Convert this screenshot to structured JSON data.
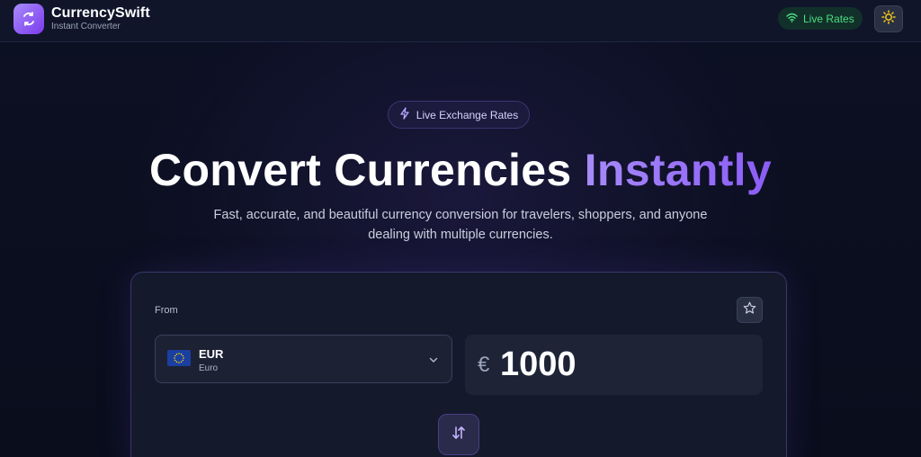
{
  "header": {
    "brand_name": "CurrencySwift",
    "brand_subtitle": "Instant Converter",
    "live_rates_label": "Live Rates",
    "theme_icon": "sun-icon",
    "logo_icon": "currency-exchange-icon"
  },
  "hero": {
    "badge_label": "Live Exchange Rates",
    "badge_icon": "lightning-icon",
    "headline_main": "Convert Currencies ",
    "headline_accent": "Instantly",
    "subtitle": "Fast, accurate, and beautiful currency conversion for travelers, shoppers, and anyone dealing with multiple currencies."
  },
  "converter": {
    "from_label": "From",
    "from_currency": {
      "code": "EUR",
      "name": "Euro",
      "flag_icon": "eu-flag-icon"
    },
    "amount_symbol": "€",
    "amount_value": "1000",
    "favorite_icon": "star-icon",
    "swap_icon": "swap-vertical-icon"
  },
  "colors": {
    "accent": "#8b5cf6",
    "live_green": "#4ade80",
    "background": "#0b0f20"
  }
}
